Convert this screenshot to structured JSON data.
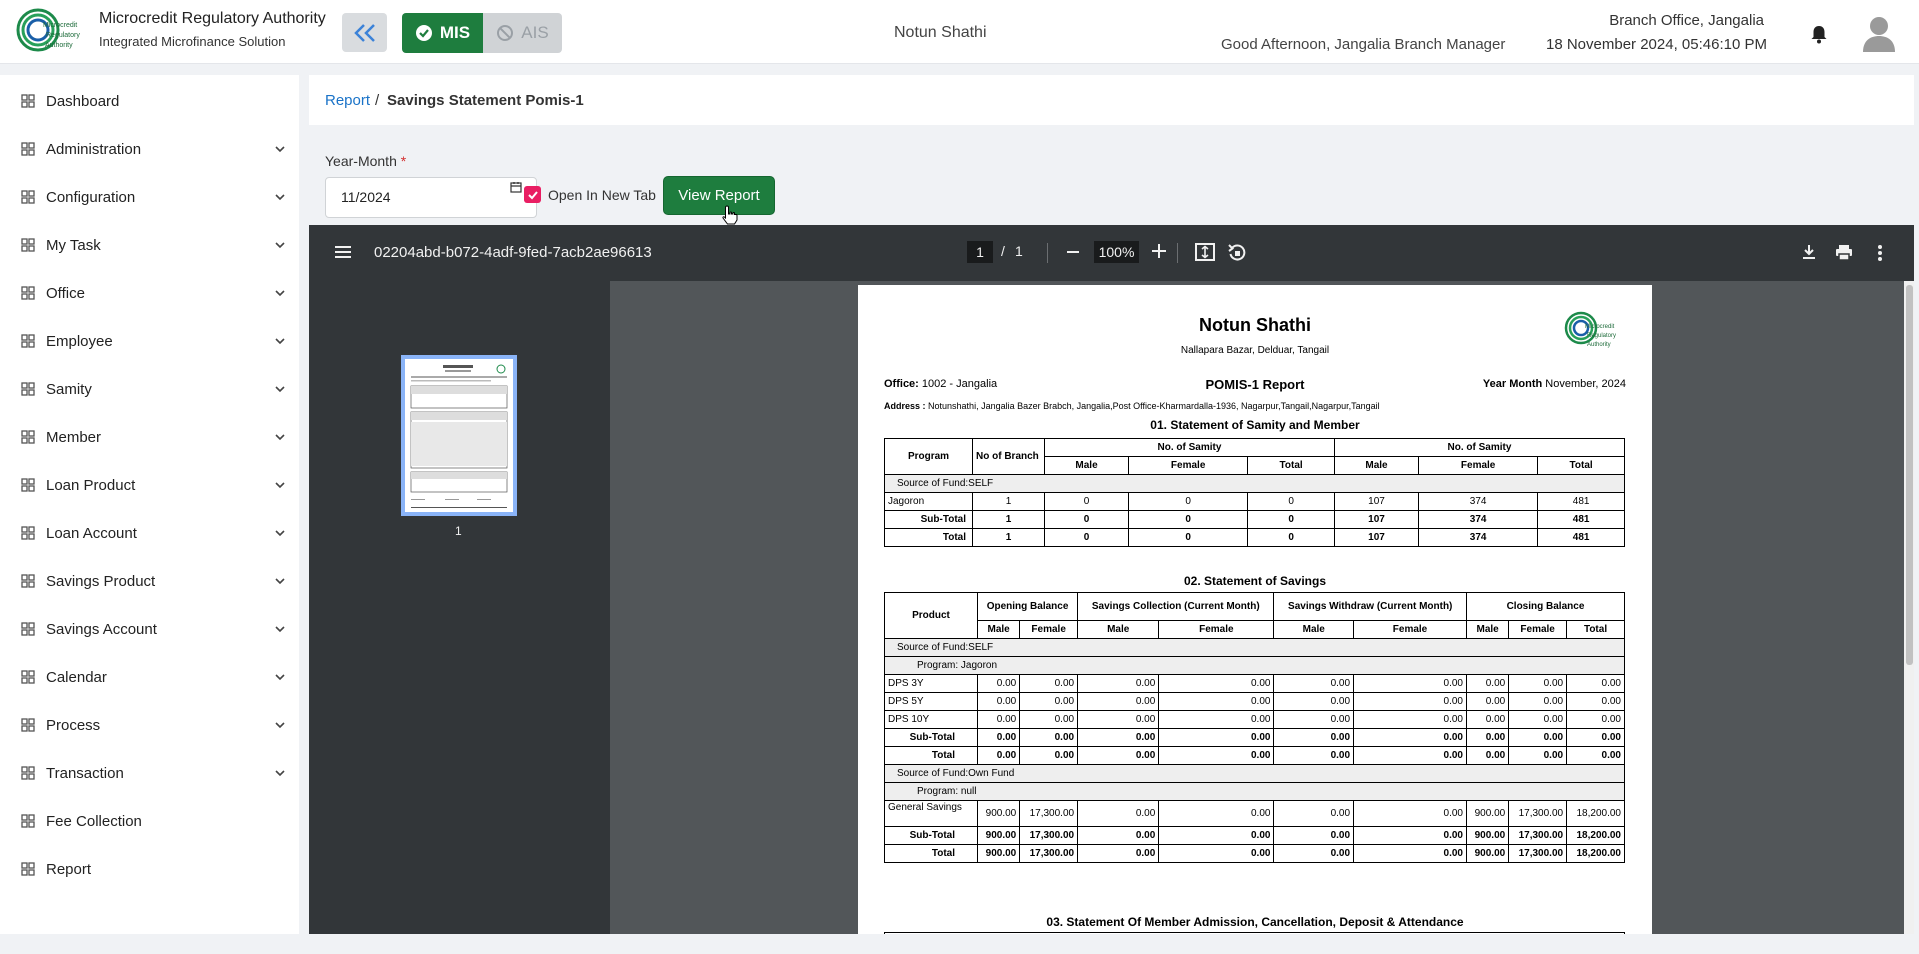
{
  "header": {
    "org_name": "Microcredit Regulatory Authority",
    "org_sub": "Integrated Microfinance Solution",
    "logo_text": [
      "Microcredit",
      "Regulatory",
      "Authority"
    ],
    "mis_label": "MIS",
    "ais_label": "AIS",
    "center_title": "Notun Shathi",
    "branch": "Branch Office, Jangalia",
    "greeting": "Good Afternoon, Jangalia Branch Manager",
    "datetime": "18 November 2024, 05:46:10 PM"
  },
  "sidebar": {
    "items": [
      {
        "label": "Dashboard",
        "icon": "dashboard-icon",
        "expand": false
      },
      {
        "label": "Administration",
        "icon": "admin-icon",
        "expand": true
      },
      {
        "label": "Configuration",
        "icon": "config-icon",
        "expand": true
      },
      {
        "label": "My Task",
        "icon": "task-icon",
        "expand": true
      },
      {
        "label": "Office",
        "icon": "office-icon",
        "expand": true
      },
      {
        "label": "Employee",
        "icon": "employee-icon",
        "expand": true
      },
      {
        "label": "Samity",
        "icon": "samity-icon",
        "expand": true
      },
      {
        "label": "Member",
        "icon": "member-icon",
        "expand": true
      },
      {
        "label": "Loan Product",
        "icon": "loan-product-icon",
        "expand": true
      },
      {
        "label": "Loan Account",
        "icon": "loan-account-icon",
        "expand": true
      },
      {
        "label": "Savings Product",
        "icon": "savings-product-icon",
        "expand": true
      },
      {
        "label": "Savings Account",
        "icon": "savings-account-icon",
        "expand": true
      },
      {
        "label": "Calendar",
        "icon": "calendar-icon",
        "expand": true
      },
      {
        "label": "Process",
        "icon": "process-icon",
        "expand": true
      },
      {
        "label": "Transaction",
        "icon": "transaction-icon",
        "expand": true
      },
      {
        "label": "Fee Collection",
        "icon": "fee-icon",
        "expand": false
      },
      {
        "label": "Report",
        "icon": "report-icon",
        "expand": false
      }
    ]
  },
  "breadcrumb": {
    "link": "Report",
    "sep": "/",
    "current": "Savings Statement Pomis-1"
  },
  "form": {
    "year_month_label": "Year-Month",
    "required_mark": "*",
    "year_month_value": "11/2024",
    "open_new_tab_label": "Open In New Tab",
    "open_new_tab_checked": true,
    "view_button": "View Report"
  },
  "viewer": {
    "filename": "02204abd-b072-4adf-9fed-7acb2ae96613",
    "page_current": "1",
    "page_sep": "/",
    "page_total": "1",
    "zoom": "100%",
    "thumb_number": "1"
  },
  "report": {
    "org": "Notun Shathi",
    "org_address": "Nallapara Bazar, Delduar, Tangail",
    "office_label": "Office:",
    "office_value": "1002 - Jangalia",
    "title": "POMIS-1 Report",
    "year_month_label": "Year Month",
    "year_month_value": "November, 2024",
    "address_label": "Address :",
    "address_value": "Notunshathi, Jangalia Bazer Brabch, Jangalia,Post Office-Kharmardalla-1936, Nagarpur,Tangail,Nagarpur,Tangail",
    "sec1": "01. Statement of Samity and Member",
    "sec2": "02. Statement of Savings",
    "sec3": "03. Statement Of Member Admission, Cancellation, Deposit & Attendance",
    "t1": {
      "h_program": "Program",
      "h_branch": "No of Branch",
      "h_samity1": "No. of Samity",
      "h_samity2": "No. of Samity",
      "h_sub": [
        "Male",
        "Female",
        "Total",
        "Male",
        "Female",
        "Total"
      ],
      "fund": "Source of Fund:SELF",
      "rows": [
        {
          "name": "Jagoron",
          "bold": false,
          "vals": [
            "1",
            "0",
            "0",
            "0",
            "107",
            "374",
            "481"
          ]
        },
        {
          "name": "Sub-Total",
          "bold": true,
          "vals": [
            "1",
            "0",
            "0",
            "0",
            "107",
            "374",
            "481"
          ]
        },
        {
          "name": "Total",
          "bold": true,
          "vals": [
            "1",
            "0",
            "0",
            "0",
            "107",
            "374",
            "481"
          ]
        }
      ]
    },
    "t2": {
      "h_product": "Product",
      "h_groups": [
        "Opening Balance",
        "Savings Collection (Current Month)",
        "Savings Withdraw (Current Month)",
        "Closing Balance"
      ],
      "h_sub": [
        "Male",
        "Female",
        "Male",
        "Female",
        "Male",
        "Female",
        "Male",
        "Female",
        "Total"
      ],
      "blocks": [
        {
          "fund": "Source of Fund:SELF",
          "program": "Program: Jagoron",
          "rows": [
            {
              "name": "DPS 3Y",
              "bold": false,
              "vals": [
                "0.00",
                "0.00",
                "0.00",
                "0.00",
                "0.00",
                "0.00",
                "0.00",
                "0.00",
                "0.00"
              ]
            },
            {
              "name": "DPS 5Y",
              "bold": false,
              "vals": [
                "0.00",
                "0.00",
                "0.00",
                "0.00",
                "0.00",
                "0.00",
                "0.00",
                "0.00",
                "0.00"
              ]
            },
            {
              "name": "DPS 10Y",
              "bold": false,
              "vals": [
                "0.00",
                "0.00",
                "0.00",
                "0.00",
                "0.00",
                "0.00",
                "0.00",
                "0.00",
                "0.00"
              ]
            },
            {
              "name": "Sub-Total",
              "bold": true,
              "vals": [
                "0.00",
                "0.00",
                "0.00",
                "0.00",
                "0.00",
                "0.00",
                "0.00",
                "0.00",
                "0.00"
              ]
            },
            {
              "name": "Total",
              "bold": true,
              "vals": [
                "0.00",
                "0.00",
                "0.00",
                "0.00",
                "0.00",
                "0.00",
                "0.00",
                "0.00",
                "0.00"
              ]
            }
          ]
        },
        {
          "fund": "Source of Fund:Own Fund",
          "program": "Program: null",
          "rows": [
            {
              "name": "General Savings",
              "bold": false,
              "vals": [
                "900.00",
                "17,300.00",
                "0.00",
                "0.00",
                "0.00",
                "0.00",
                "900.00",
                "17,300.00",
                "18,200.00"
              ]
            },
            {
              "name": "Sub-Total",
              "bold": true,
              "vals": [
                "900.00",
                "17,300.00",
                "0.00",
                "0.00",
                "0.00",
                "0.00",
                "900.00",
                "17,300.00",
                "18,200.00"
              ]
            },
            {
              "name": "Total",
              "bold": true,
              "vals": [
                "900.00",
                "17,300.00",
                "0.00",
                "0.00",
                "0.00",
                "0.00",
                "900.00",
                "17,300.00",
                "18,200.00"
              ]
            }
          ]
        }
      ]
    }
  }
}
